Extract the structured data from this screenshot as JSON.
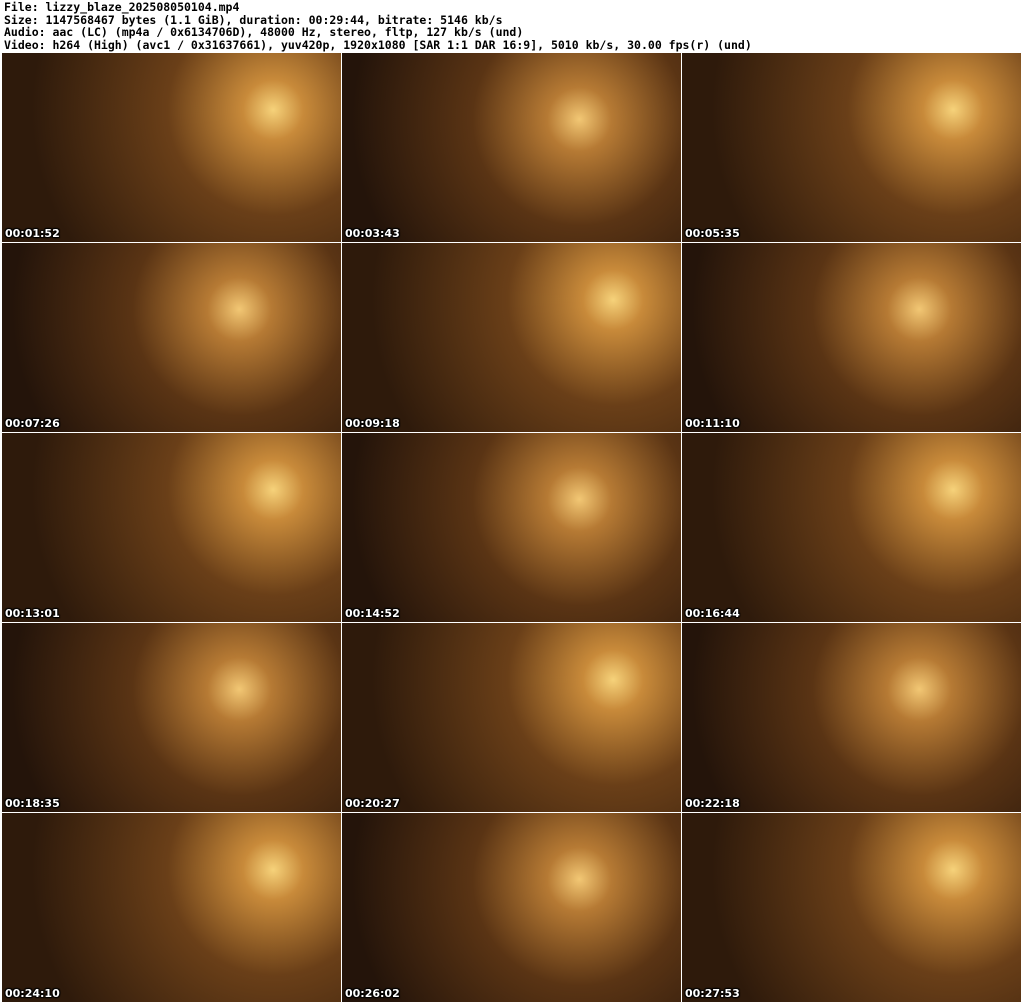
{
  "header": {
    "file": "File: lizzy_blaze_202508050104.mp4",
    "size": "Size: 1147568467 bytes (1.1 GiB), duration: 00:29:44, bitrate: 5146 kb/s",
    "audio": "Audio: aac (LC) (mp4a / 0x6134706D), 48000 Hz, stereo, fltp, 127 kb/s (und)",
    "video": "Video: h264 (High) (avc1 / 0x31637661), yuv420p, 1920x1080 [SAR 1:1 DAR 16:9], 5010 kb/s, 30.00 fps(r) (und)"
  },
  "thumbnails": [
    {
      "timestamp": "00:01:52"
    },
    {
      "timestamp": "00:03:43"
    },
    {
      "timestamp": "00:05:35"
    },
    {
      "timestamp": "00:07:26"
    },
    {
      "timestamp": "00:09:18"
    },
    {
      "timestamp": "00:11:10"
    },
    {
      "timestamp": "00:13:01"
    },
    {
      "timestamp": "00:14:52"
    },
    {
      "timestamp": "00:16:44"
    },
    {
      "timestamp": "00:18:35"
    },
    {
      "timestamp": "00:20:27"
    },
    {
      "timestamp": "00:22:18"
    },
    {
      "timestamp": "00:24:10"
    },
    {
      "timestamp": "00:26:02"
    },
    {
      "timestamp": "00:27:53"
    }
  ]
}
